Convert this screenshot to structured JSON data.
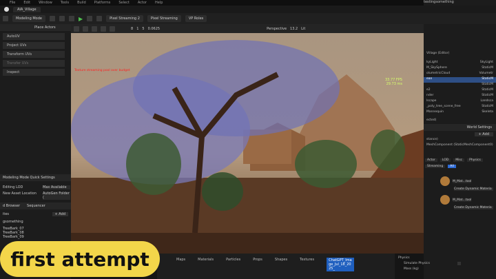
{
  "menu": {
    "items": [
      "File",
      "Edit",
      "Window",
      "Tools",
      "Build",
      "Platforms",
      "Select",
      "Actor",
      "Help"
    ],
    "project": "testingsomething"
  },
  "tabs": {
    "level": "AIA_Village"
  },
  "toolbar": {
    "mode": "Modeling Mode",
    "pixel_streaming_2": "Pixel Streaming 2",
    "pixel_streaming": "Pixel Streaming",
    "vp_roles": "VP Roles"
  },
  "left_panel": {
    "place_actors": "Place Actors",
    "tools": [
      "AutoUV",
      "Project UVs",
      "Transform UVs",
      "Transfer UVs",
      "Inspect"
    ],
    "quick_settings_title": "Modeling Mode Quick Settings",
    "editing_lod_label": "Editing LOD",
    "editing_lod_value": "Max Available",
    "new_asset_label": "New Asset Location",
    "new_asset_value": "AutoGen Folder (",
    "content_browser": "d Browser",
    "sequencer": "Sequencer",
    "add_label": "+ Add",
    "favorites": "ites",
    "project_folder": "gsomething",
    "files": [
      "TreeBark_07",
      "TreeBark_08",
      "TreeBark_09"
    ]
  },
  "viewport": {
    "perspective": "Perspective",
    "lit": "Lit",
    "snap_value": "0.0625",
    "fov": "13.2",
    "grid_a": "8",
    "grid_b": "1",
    "grid_c": "5",
    "fps": "33.77 FPS",
    "ms": "29.73 ms",
    "overlay_text": "Texture streaming pool over budget"
  },
  "right_panel": {
    "outliner_top": "Village (Editor)",
    "rows": [
      {
        "name": "kyLight",
        "type": "SkyLight"
      },
      {
        "name": "M_SkySphere",
        "type": "StaticM"
      },
      {
        "name": "olumetricCloud",
        "type": "Volumetr"
      },
      {
        "name": "ean",
        "type": "StaticM"
      },
      {
        "name": "",
        "type": "StaticM"
      },
      {
        "name": "e2",
        "type": "StaticM"
      },
      {
        "name": "nder",
        "type": "StaticM"
      },
      {
        "name": "lscape",
        "type": "Landsca"
      },
      {
        "name": "_poly_tree_scene_free",
        "type": "StaticM"
      },
      {
        "name": "Mannequin",
        "type": "Skeleta"
      }
    ],
    "selected_info": "ected)",
    "world_settings": "World Settings",
    "add_label": "+ Add",
    "instance": "stance)",
    "component": "MeshComponent (StaticMeshComponent0)",
    "filters": [
      "Actor",
      "LOD",
      "Misc",
      "Physics",
      "Streaming",
      "All"
    ],
    "material_slot_1": "M_Mat...tool",
    "material_slot_2": "M_Mat...tool",
    "create_dynamic_1": "Create Dynamic Materia",
    "create_dynamic_2": "Create Dynamic Materia",
    "physics": "Physics",
    "simulate_physics": "Simulate Physics",
    "mass": "Mass (kg)"
  },
  "bottom_bar": {
    "tabs": [
      "Maps",
      "Materials",
      "Particles",
      "Props",
      "Shapes",
      "Textures"
    ],
    "highlighted": "ChatGPT_Image_Jul_18_2025_"
  },
  "caption": "first attempt",
  "colors": {
    "selection": "#2e4f86",
    "caption_bg": "#f3d64a",
    "play_green": "#4fc04f",
    "fps_text": "#d6ff6a"
  }
}
